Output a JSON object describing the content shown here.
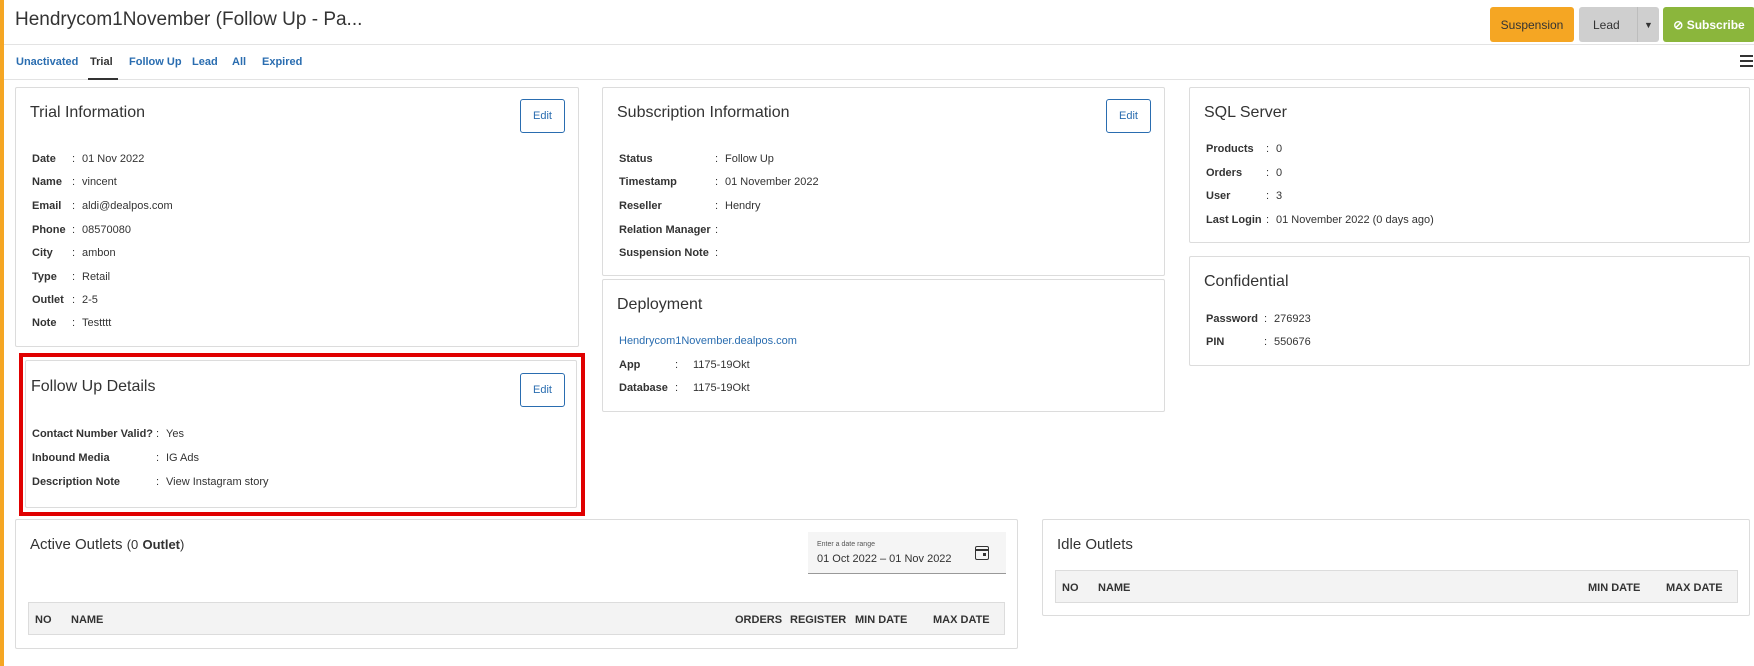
{
  "header": {
    "title": "Hendrycom1November (Follow Up - Pa...",
    "suspension_label": "Suspension",
    "lead_label": "Lead",
    "subscribe_label": "Subscribe"
  },
  "tabs": [
    {
      "label": "Unactivated"
    },
    {
      "label": "Trial"
    },
    {
      "label": "Follow Up"
    },
    {
      "label": "Lead"
    },
    {
      "label": "All"
    },
    {
      "label": "Expired"
    }
  ],
  "active_tab": "Trial",
  "edit_label": "Edit",
  "trial": {
    "title": "Trial Information",
    "rows": [
      {
        "label": "Date",
        "value": "01 Nov 2022"
      },
      {
        "label": "Name",
        "value": "vincent"
      },
      {
        "label": "Email",
        "value": "aldi@dealpos.com"
      },
      {
        "label": "Phone",
        "value": "08570080"
      },
      {
        "label": "City",
        "value": "ambon"
      },
      {
        "label": "Type",
        "value": "Retail"
      },
      {
        "label": "Outlet",
        "value": "2-5"
      },
      {
        "label": "Note",
        "value": "Testttt"
      }
    ]
  },
  "subscription": {
    "title": "Subscription Information",
    "rows": [
      {
        "label": "Status",
        "value": "Follow Up"
      },
      {
        "label": "Timestamp",
        "value": "01 November 2022"
      },
      {
        "label": "Reseller",
        "value": "Hendry"
      },
      {
        "label": "Relation Manager",
        "value": ""
      },
      {
        "label": "Suspension Note",
        "value": ""
      }
    ]
  },
  "sql": {
    "title": "SQL Server",
    "rows": [
      {
        "label": "Products",
        "value": "0"
      },
      {
        "label": "Orders",
        "value": "0"
      },
      {
        "label": "User",
        "value": "3"
      },
      {
        "label": "Last Login",
        "value": "01 November 2022 (0 days ago)"
      }
    ]
  },
  "confidential": {
    "title": "Confidential",
    "rows": [
      {
        "label": "Password",
        "value": "276923"
      },
      {
        "label": "PIN",
        "value": "550676"
      }
    ]
  },
  "deployment": {
    "title": "Deployment",
    "url": "Hendrycom1November.dealpos.com",
    "rows": [
      {
        "label": "App",
        "value": "1175-19Okt"
      },
      {
        "label": "Database",
        "value": "1175-19Okt"
      }
    ]
  },
  "followup": {
    "title": "Follow Up Details",
    "rows": [
      {
        "label": "Contact Number Valid?",
        "value": "Yes"
      },
      {
        "label": "Inbound Media",
        "value": "IG Ads"
      },
      {
        "label": "Description Note",
        "value": "View Instagram story"
      }
    ]
  },
  "active_outlets": {
    "title_prefix": "Active Outlets",
    "count_text": "(0",
    "unit": "Outlet",
    "close_paren": ")",
    "date_hint": "Enter a date range",
    "date_value": "01 Oct 2022 – 01 Nov 2022",
    "columns": [
      "NO",
      "NAME",
      "ORDERS",
      "REGISTER",
      "MIN DATE",
      "MAX DATE"
    ]
  },
  "idle_outlets": {
    "title": "Idle Outlets",
    "columns": [
      "NO",
      "NAME",
      "MIN DATE",
      "MAX DATE"
    ]
  },
  "colors": {
    "accent": "#f5a623",
    "link": "#2a6db0",
    "subscribe": "#8bb63c",
    "highlight": "#e00000"
  }
}
